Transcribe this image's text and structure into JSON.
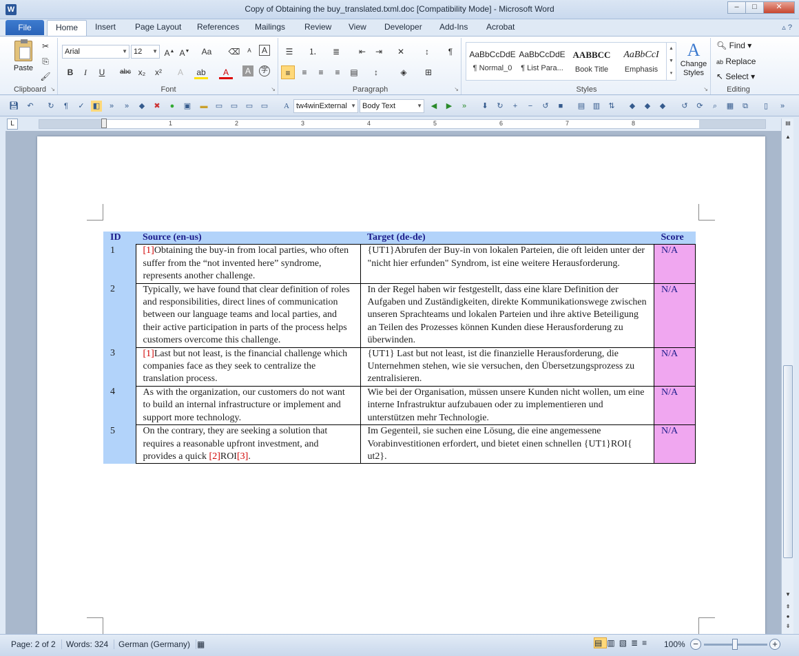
{
  "window": {
    "title": "Copy of Obtaining the buy_translated.txml.doc [Compatibility Mode] - Microsoft Word",
    "app_icon_letter": "W",
    "minimize": "–",
    "maximize": "□",
    "close": "✕"
  },
  "tabs": {
    "file": "File",
    "items": [
      "Home",
      "Insert",
      "Page Layout",
      "References",
      "Mailings",
      "Review",
      "View",
      "Developer",
      "Add-Ins",
      "Acrobat"
    ]
  },
  "ribbon": {
    "clipboard": {
      "label": "Clipboard",
      "paste": "Paste"
    },
    "font": {
      "label": "Font",
      "name": "Arial",
      "size": "12"
    },
    "paragraph": {
      "label": "Paragraph"
    },
    "styles": {
      "label": "Styles",
      "items": [
        {
          "preview": "AaBbCcDdE",
          "name": "¶ Normal_0"
        },
        {
          "preview": "AaBbCcDdE",
          "name": "¶ List Para..."
        },
        {
          "preview": "AABBCC",
          "name": "Book Title"
        },
        {
          "preview": "AaBbCcI",
          "name": "Emphasis"
        }
      ],
      "change_styles": "Change Styles"
    },
    "editing": {
      "label": "Editing",
      "find": "Find",
      "replace": "Replace",
      "select": "Select"
    }
  },
  "qat": {
    "style_combo1": "tw4winExternal",
    "style_combo2": "Body Text"
  },
  "ruler": {
    "numbers": [
      "1",
      "2",
      "3",
      "4",
      "5",
      "6",
      "7",
      "8"
    ]
  },
  "table": {
    "headers": [
      "ID",
      "Source (en-us)",
      "Target (de-de)",
      "Score"
    ],
    "rows": [
      {
        "id": "1",
        "src_tag1": "[1]",
        "src": "Obtaining the buy-in from local parties, who often suffer from the “not invented here” syndrome, represents another challenge.",
        "tgt": "{UT1}Abrufen der Buy-in von lokalen Parteien, die oft leiden unter der \"nicht hier erfunden\" Syndrom, ist eine weitere Herausforderung.",
        "score": "N/A"
      },
      {
        "id": "2",
        "src": "Typically, we have found that clear definition of roles and responsibilities, direct lines of communication between our language teams and local parties, and their active participation in parts of the process helps customers overcome this challenge.",
        "tgt": "In der Regel haben wir festgestellt, dass eine klare Definition der Aufgaben und Zuständigkeiten, direkte Kommunikationswege zwischen unseren Sprachteams und lokalen Parteien und ihre aktive Beteiligung an Teilen des Prozesses können Kunden diese Herausforderung zu überwinden.",
        "score": "N/A"
      },
      {
        "id": "3",
        "src_tag1": "[1]",
        "src": "Last but not least, is the financial challenge which companies face as they seek to centralize the translation process.",
        "tgt": "{UT1}  Last but not least, ist die finanzielle Herausforderung, die Unternehmen stehen, wie sie versuchen, den Übersetzungsprozess zu zentralisieren.",
        "score": "N/A"
      },
      {
        "id": "4",
        "src": "As with the organization, our customers do not want to build an internal infrastructure or implement and support more technology.",
        "tgt": "Wie bei der Organisation, müssen unsere Kunden nicht wollen, um eine interne Infrastruktur aufzubauen oder zu implementieren und unterstützen mehr Technologie.",
        "score": "N/A"
      },
      {
        "id": "5",
        "src": "On the contrary, they are seeking a solution that requires a reasonable upfront investment, and provides a quick ",
        "src_tag2": "[2]",
        "src_tail": "ROI",
        "src_tag3": "[3]",
        "src_end": ".",
        "tgt": "Im Gegenteil, sie suchen eine Lösung, die eine angemessene Vorabinvestitionen erfordert, und bietet einen schnellen {UT1}ROI{ ut2}.",
        "score": "N/A"
      }
    ]
  },
  "status": {
    "page": "Page: 2 of 2",
    "words": "Words: 324",
    "language": "German (Germany)",
    "zoom": "100%"
  }
}
